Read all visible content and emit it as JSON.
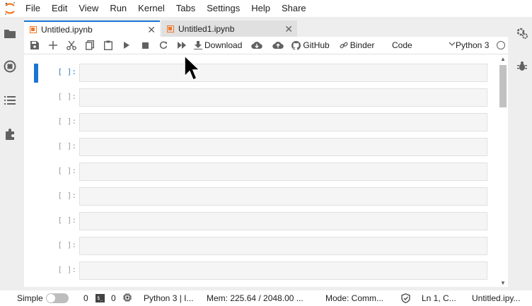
{
  "menu": {
    "items": [
      "File",
      "Edit",
      "View",
      "Run",
      "Kernel",
      "Tabs",
      "Settings",
      "Help",
      "Share"
    ]
  },
  "left_sidebar": {
    "icons": [
      "folder-icon",
      "running-icon",
      "toc-icon",
      "extension-icon"
    ]
  },
  "right_sidebar": {
    "icons": [
      "property-inspector-icon",
      "debugger-icon"
    ]
  },
  "tabs": [
    {
      "label": "Untitled.ipynb",
      "active": true
    },
    {
      "label": "Untitled1.ipynb",
      "active": false
    }
  ],
  "toolbar": {
    "download_label": "Download",
    "github_label": "GitHub",
    "binder_label": "Binder",
    "cell_type": "Code",
    "kernel": "Python 3"
  },
  "cells": [
    {
      "prompt": "[ ]:"
    },
    {
      "prompt": "[ ]:"
    },
    {
      "prompt": "[ ]:"
    },
    {
      "prompt": "[ ]:"
    },
    {
      "prompt": "[ ]:"
    },
    {
      "prompt": "[ ]:"
    },
    {
      "prompt": "[ ]:"
    },
    {
      "prompt": "[ ]:"
    },
    {
      "prompt": "[ ]:"
    }
  ],
  "statusbar": {
    "mode_toggle_label": "Simple",
    "terminals_count": "0",
    "kernels_count": "0",
    "kernel_info": "Python 3 | I...",
    "memory": "Mem: 225.64 / 2048.00 ...",
    "mode": "Mode: Comm...",
    "position": "Ln 1, C...",
    "file": "Untitled.ipy..."
  },
  "colors": {
    "accent": "#1976d2",
    "notebook_orange": "#f37726",
    "prompt_active": "#307fc1"
  }
}
